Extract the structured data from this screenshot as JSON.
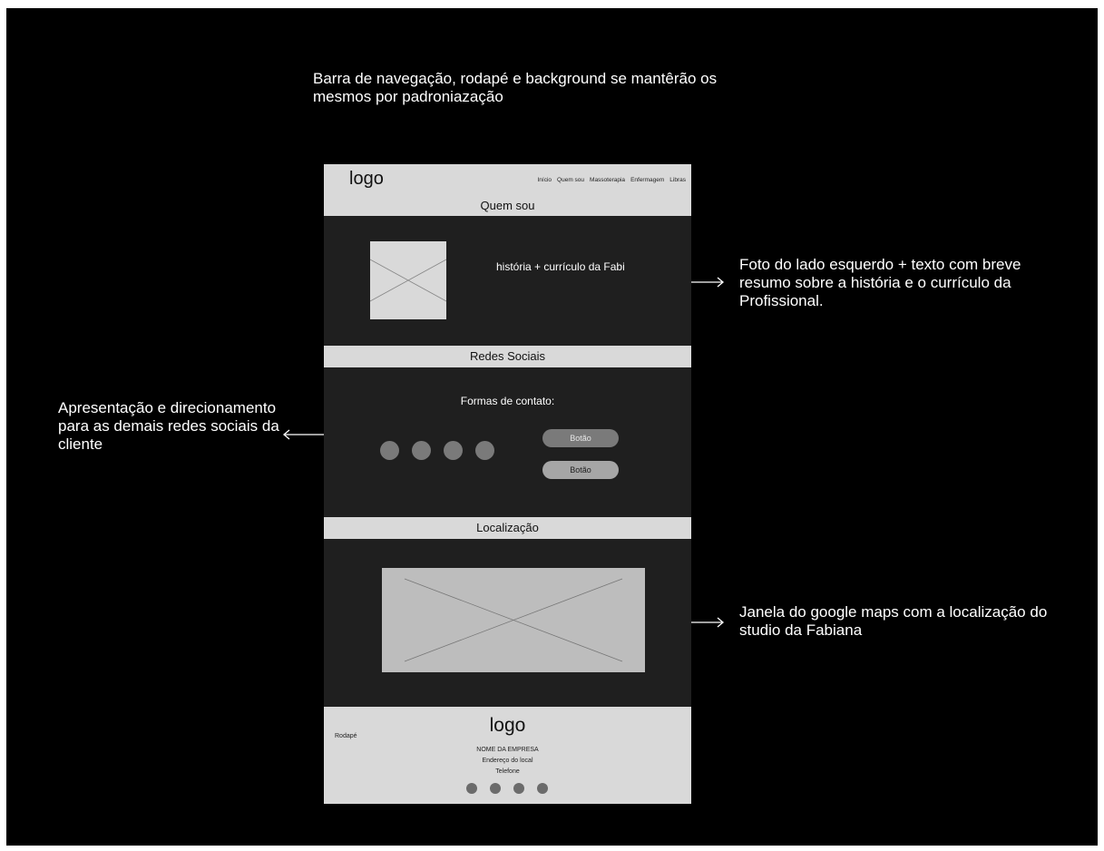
{
  "annotations": {
    "top": "Barra de navegação, rodapé e background se mantêrão os mesmos por padroniazação",
    "about": "Foto do lado esquerdo + texto com breve resumo sobre a história e o currículo da Profissional.",
    "social": "Apresentação e direcionamento para as demais redes sociais da cliente",
    "map": "Janela do google maps com a localização do studio da Fabiana"
  },
  "wireframe": {
    "logo": "logo",
    "nav": [
      "Início",
      "Quem sou",
      "Massoterapia",
      "Enfermagem",
      "Libras"
    ],
    "about": {
      "title": "Quem sou",
      "text": "história + currículo da Fabi"
    },
    "social": {
      "title": "Redes Sociais",
      "subtitle": "Formas de contato:",
      "icon_count": 4,
      "buttons": [
        "Botão",
        "Botão"
      ]
    },
    "location": {
      "title": "Localização"
    },
    "footer": {
      "label": "Rodapé",
      "logo": "logo",
      "company": "NOME DA EMPRESA",
      "address": "Endereço do local",
      "phone": "Telefone",
      "icon_count": 4
    }
  },
  "colors": {
    "background": "#000000",
    "bar": "#d9d9d9",
    "section": "#1f1f1f",
    "placeholder": "#7a7a7a"
  }
}
